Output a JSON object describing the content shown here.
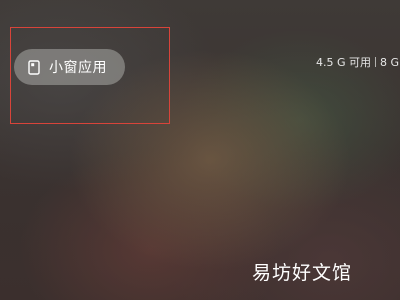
{
  "small_window_button": {
    "label": "小窗应用",
    "icon": "small-window-icon"
  },
  "storage": {
    "available": "4.5 G 可用",
    "total_partial": "8 G"
  },
  "watermark": {
    "text": "易坊好文馆"
  },
  "colors": {
    "highlight_border": "#d8443a",
    "pill_bg": "rgba(170,170,165,0.55)",
    "text": "#ffffff"
  }
}
